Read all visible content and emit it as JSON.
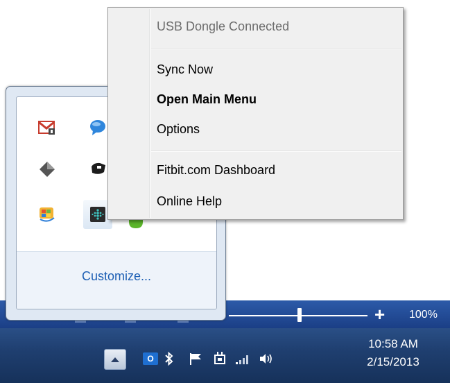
{
  "menu": {
    "items": [
      {
        "label": "USB Dongle Connected"
      },
      {
        "label": "Sync Now"
      },
      {
        "label": "Open Main Menu"
      },
      {
        "label": "Options"
      },
      {
        "label": "Fitbit.com Dashboard"
      },
      {
        "label": "Online Help"
      }
    ]
  },
  "overflow": {
    "customize_label": "Customize..."
  },
  "statusbar": {
    "zoom_percent": "100%",
    "zoom_plus": "+"
  },
  "taskbar": {
    "time": "10:58 AM",
    "date": "2/15/2013",
    "outlook_icon_text": "O"
  },
  "colors": {
    "accent": "#1d5fb4",
    "taskbar": "#1f3f70",
    "statusbar": "#2c5aa8"
  }
}
